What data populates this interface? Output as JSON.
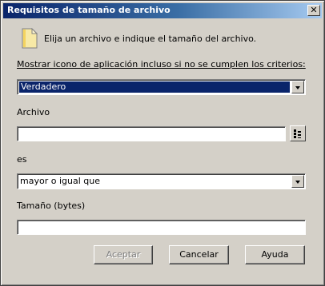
{
  "window": {
    "title": "Requisitos de tamaño de archivo",
    "close_symbol": "✕"
  },
  "header": {
    "icon": "document-icon",
    "text": "Elija un archivo e indique el tamaño del archivo."
  },
  "show_icon": {
    "label": "Mostrar icono de aplicación incluso si no se cumplen los criterios:",
    "selected": "Verdadero"
  },
  "file": {
    "label": "Archivo",
    "value": "",
    "browse_icon": "browse-tree-icon"
  },
  "operator": {
    "label": "es",
    "selected": "mayor o igual que"
  },
  "size": {
    "label": "Tamaño (bytes)",
    "value": ""
  },
  "buttons": {
    "accept": "Aceptar",
    "cancel": "Cancelar",
    "help": "Ayuda"
  },
  "colors": {
    "title_start": "#0a246a",
    "title_end": "#a6caf0",
    "selection": "#0a246a",
    "face": "#d4d0c8"
  }
}
